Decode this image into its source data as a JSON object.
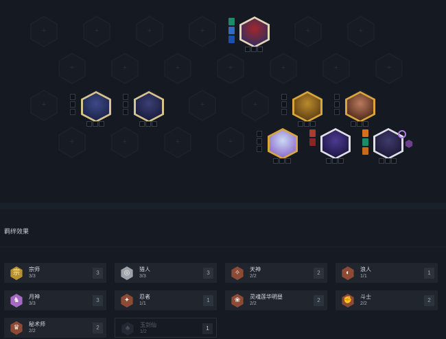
{
  "board": {
    "empty_slot_symbol": "+",
    "units": [
      {
        "name": "row1-unit",
        "frame": "#e3d6b8",
        "fill": "#a1262a",
        "fill2": "#2d2f63",
        "equipment": [
          "#1d8a6a",
          "#2f6cc8",
          "#1b4fb5"
        ]
      },
      {
        "name": "row3-unit-1",
        "frame": "#d7c38c",
        "fill": "#3c4a86",
        "fill2": "#1a2147"
      },
      {
        "name": "row3-unit-2",
        "frame": "#d7c38c",
        "fill": "#3b3f74",
        "fill2": "#161a3a"
      },
      {
        "name": "row3-unit-3",
        "frame": "#d8a73b",
        "fill": "#b98a2d",
        "fill2": "#5a3b12"
      },
      {
        "name": "row3-unit-4",
        "frame": "#d8a73b",
        "fill": "#b97a5e",
        "fill2": "#4b2416"
      },
      {
        "name": "row4-unit-1",
        "frame": "#d8a73b",
        "fill": "#c9d9f4",
        "fill2": "#8a66c9"
      },
      {
        "name": "row4-unit-2",
        "frame": "#e0dfe8",
        "fill": "#4c3a8f",
        "fill2": "#1a1440",
        "equipment": [
          "#a93b2f",
          "#8c2626"
        ]
      },
      {
        "name": "row4-unit-3",
        "frame": "#e0dfe8",
        "fill": "#3e3a6c",
        "fill2": "#1a1733",
        "equipment": [
          "#d5701f",
          "#1d8a6a",
          "#c96a1a"
        ]
      }
    ]
  },
  "traits_panel": {
    "title": "羁绊效果",
    "traits": [
      {
        "name": "宗师",
        "count": "3/3",
        "level": "3",
        "icon": "宗",
        "color": "#b8902f",
        "active": true
      },
      {
        "name": "猎人",
        "count": "3/3",
        "level": "3",
        "icon": "◎",
        "color": "#9ea2aa",
        "active": true
      },
      {
        "name": "天神",
        "count": "2/2",
        "level": "2",
        "icon": "✧",
        "color": "#8d4a35",
        "active": true
      },
      {
        "name": "浪人",
        "count": "1/1",
        "level": "1",
        "icon": "◐",
        "color": "#8d4a35",
        "active": true
      },
      {
        "name": "月神",
        "count": "3/3",
        "level": "3",
        "icon": "♞",
        "color": "#a56ac4",
        "active": true
      },
      {
        "name": "忍者",
        "count": "1/1",
        "level": "1",
        "icon": "✦",
        "color": "#8d4a35",
        "active": true
      },
      {
        "name": "灵魂莲华明昼",
        "count": "2/2",
        "level": "2",
        "icon": "❀",
        "color": "#8d4a35",
        "active": true
      },
      {
        "name": "斗士",
        "count": "2/2",
        "level": "2",
        "icon": "✊",
        "color": "#8d4a35",
        "active": true
      },
      {
        "name": "秘术师",
        "count": "2/2",
        "level": "2",
        "icon": "♛",
        "color": "#8d4a35",
        "active": true
      },
      {
        "name": "玉剑仙",
        "count": "1/2",
        "level": "1",
        "icon": "♣",
        "color": "#232833",
        "active": false
      }
    ]
  }
}
